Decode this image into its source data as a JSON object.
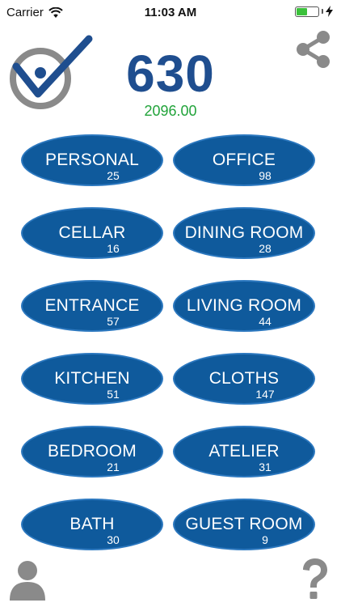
{
  "status": {
    "carrier": "Carrier",
    "time": "11:03 AM"
  },
  "summary": {
    "total": "630",
    "value": "2096.00"
  },
  "rooms": [
    {
      "label": "PERSONAL",
      "count": "25"
    },
    {
      "label": "OFFICE",
      "count": "98"
    },
    {
      "label": "CELLAR",
      "count": "16"
    },
    {
      "label": "DINING ROOM",
      "count": "28"
    },
    {
      "label": "ENTRANCE",
      "count": "57"
    },
    {
      "label": "LIVING ROOM",
      "count": "44"
    },
    {
      "label": "KITCHEN",
      "count": "51"
    },
    {
      "label": "CLOTHS",
      "count": "147"
    },
    {
      "label": "BEDROOM",
      "count": "21"
    },
    {
      "label": "ATELIER",
      "count": "31"
    },
    {
      "label": "BATH",
      "count": "30"
    },
    {
      "label": "GUEST ROOM",
      "count": "9"
    }
  ],
  "colors": {
    "brand_blue": "#1f4e8f",
    "button_blue": "#0f5a9c",
    "value_green": "#21a33a",
    "icon_gray": "#8a8a8a"
  },
  "icons": {
    "logo": "checkmark-person-logo",
    "share": "share-icon",
    "user": "user-icon",
    "help": "help-icon"
  }
}
